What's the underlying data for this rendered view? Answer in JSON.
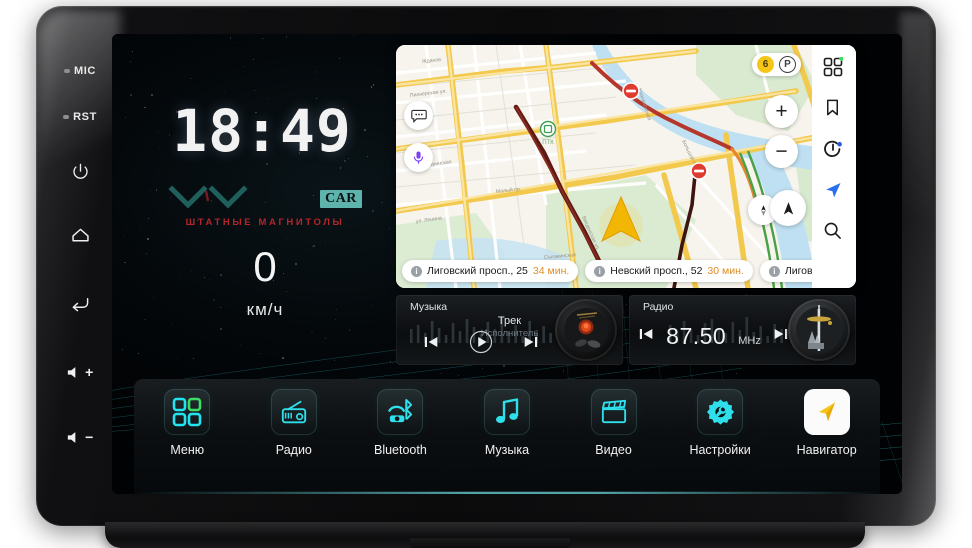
{
  "device": {
    "side_buttons": [
      {
        "name": "mic",
        "label": "MIC",
        "type": "led-label"
      },
      {
        "name": "reset",
        "label": "RST",
        "type": "led-label"
      },
      {
        "name": "power",
        "label": "",
        "icon": "power-icon"
      },
      {
        "name": "home",
        "label": "",
        "icon": "home-icon"
      },
      {
        "name": "back",
        "label": "",
        "icon": "back-arrow-icon"
      },
      {
        "name": "volume-up",
        "label": "+",
        "icon": "speaker-plus-icon"
      },
      {
        "name": "volume-down",
        "label": "-",
        "icon": "speaker-minus-icon"
      }
    ]
  },
  "home": {
    "clock": "18:49",
    "brand": {
      "badge": "CAR",
      "subtitle": "ШТАТНЫЕ МАГНИТОЛЫ",
      "badge_color": "#5fb3ad",
      "subtitle_color": "#b3262b"
    },
    "speed": {
      "value": "0",
      "unit": "км/ч"
    }
  },
  "map": {
    "traffic_level": "6",
    "parking_label": "P",
    "left_controls": [
      {
        "name": "chat-bubble-icon"
      },
      {
        "name": "microphone-icon"
      }
    ],
    "zoom_in": "+",
    "zoom_out": "−",
    "rail_icons": [
      {
        "name": "grid-menu-icon",
        "badge": true
      },
      {
        "name": "bookmark-icon",
        "badge": false
      },
      {
        "name": "alice-assistant-icon",
        "badge": true
      },
      {
        "name": "navigation-arrow-icon",
        "badge": false
      },
      {
        "name": "search-icon",
        "badge": false
      }
    ],
    "suggestions": [
      {
        "title": "Лиговский просп., 25",
        "eta": "34 мин."
      },
      {
        "title": "Невский просп., 52",
        "eta": "30 мин."
      },
      {
        "title": "Лиговский",
        "eta": ""
      }
    ],
    "poi_label": "ПТК",
    "street_labels": [
      "Жданов",
      "Пионерская ул.",
      "Кронверкская",
      "Зверинская",
      "ул. Ленина",
      "Введенская ул.",
      "Большой просп."
    ]
  },
  "media": {
    "music": {
      "title": "Музыка",
      "track": "Трек",
      "artist": "Исполнитель",
      "prev": "prev-track-button",
      "play": "play-button",
      "next": "next-track-button"
    },
    "radio": {
      "title": "Радио",
      "frequency": "87.50",
      "unit": "MHz",
      "prev": "prev-station-button",
      "next": "next-station-button"
    }
  },
  "dock": {
    "items": [
      {
        "label": "Меню",
        "icon": "grid-apps-icon",
        "accent": "#22e3f0"
      },
      {
        "label": "Радио",
        "icon": "radio-icon",
        "accent": "#2ee0ec"
      },
      {
        "label": "Bluetooth",
        "icon": "bluetooth-phone-icon",
        "accent": "#2ee0ec"
      },
      {
        "label": "Музыка",
        "icon": "music-note-icon",
        "accent": "#2ee0ec"
      },
      {
        "label": "Видео",
        "icon": "clapperboard-icon",
        "accent": "#2ee0ec"
      },
      {
        "label": "Настройки",
        "icon": "gear-wrench-icon",
        "accent": "#2ee0ec"
      },
      {
        "label": "Навигатор",
        "icon": "navigator-arrow-icon",
        "accent": "#f5c518"
      }
    ]
  },
  "colors": {
    "accent_cyan": "#2ee0ec",
    "accent_green": "#3ddc64",
    "accent_amber": "#e08e25",
    "screen_bg": "#020305"
  }
}
